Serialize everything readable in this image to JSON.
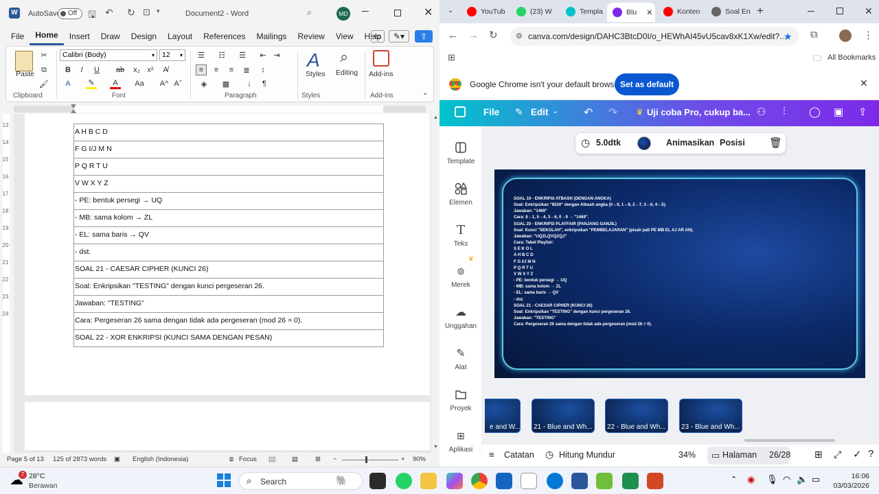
{
  "word": {
    "autosave_label": "AutoSave",
    "autosave_state": "Off",
    "doc_title": "Document2  -  Word",
    "user_initials": "MD",
    "menu": [
      "File",
      "Home",
      "Insert",
      "Draw",
      "Design",
      "Layout",
      "References",
      "Mailings",
      "Review",
      "View",
      "Help"
    ],
    "active_menu": "Home",
    "ribbon": {
      "paste": "Paste",
      "font_name": "Calibri (Body)",
      "font_size": "12",
      "styles": "Styles",
      "editing": "Editing",
      "addins": "Add-ins",
      "groups": {
        "clipboard": "Clipboard",
        "font": "Font",
        "paragraph": "Paragraph",
        "styles": "Styles",
        "addins": "Add-ins"
      }
    },
    "ruler_v_numbers": [
      "13",
      "14",
      "15",
      "16",
      "17",
      "18",
      "19",
      "20",
      "21",
      "22",
      "23",
      "24"
    ],
    "table_rows": [
      "A H B C D",
      "F G I/J M N",
      "P Q R T U",
      "V W X Y Z",
      "- PE: bentuk persegi → UQ",
      "- MB: sama kolom → ZL",
      "- EL: sama baris → QV",
      "- dst.",
      "SOAL 21 - CAESAR CIPHER (KUNCI 26)",
      "Soal: Enkripsikan \"TESTING\" dengan kunci pergeseran 26.",
      "Jawaban: \"TESTING\"",
      "Cara: Pergeseran 26 sama dengan tidak ada pergeseran (mod 26 = 0).",
      "SOAL 22 - XOR ENKRIPSI (KUNCI SAMA DENGAN PESAN)"
    ],
    "status": {
      "page": "Page 5 of 13",
      "words": "125 of 2873 words",
      "language": "English (Indonesia)",
      "focus": "Focus",
      "zoom": "90%"
    }
  },
  "chrome": {
    "tabs": [
      {
        "label": "YouTub",
        "color": "#ff0000"
      },
      {
        "label": "(23) W",
        "color": "#25d366"
      },
      {
        "label": "Templa",
        "color": "#00c4cc"
      },
      {
        "label": "Blu",
        "color": "#7d2ae8"
      },
      {
        "label": "Konten",
        "color": "#ff0000"
      },
      {
        "label": "Soal En",
        "color": "#666666"
      }
    ],
    "url": "canva.com/design/DAHC3BtcD0I/o_HEWhAI45vU5cav8xK1Xw/edit?...",
    "bookmarks_label": "All Bookmarks",
    "infobar_text": "Google Chrome isn't your default browser",
    "infobar_button": "Set as default"
  },
  "canva": {
    "file": "File",
    "edit": "Edit",
    "promo": "Uji coba Pro, cukup ba...",
    "sidebar": [
      "Template",
      "Elemen",
      "Teks",
      "Merek",
      "Unggahan",
      "Alat",
      "Proyek",
      "Aplikasi"
    ],
    "toolbar": {
      "duration": "5.0dtk",
      "animate": "Animasikan",
      "position": "Posisi"
    },
    "slide_lines": [
      "SOAL 19 - ENKRIPSI ATBASH (DENGAN ANGKA)",
      "Soal: Enkripsikan \"8530\" dengan Atbash angka (0↔9, 1↔8, 2↔7, 3↔6, 4↔5).",
      "Jawaban: \"1469\"",
      "Cara: 8→1, 5→4, 3→6, 0→9 → \"1469\".",
      "SOAL 20 - ENKRIPSI PLAYFAIR (PANJANG GANJIL)",
      "Soal: Kunci \"SEKOLAH\", enkripsikan \"PEMBELAJARAN\" (pisah jadi PE MB EL AJ AR AN).",
      "Jawaban: \"UQZLQVQZQJ\"",
      "Cara: Tabel Playfair:",
      "S E K O L",
      "A H B C D",
      "F G I/J M N",
      "P Q R T U",
      "V W X Y Z",
      "- PE: bentuk persegi → UQ",
      "- MB: sama kolom → ZL",
      "- EL: sama baris → QV",
      "- dst.",
      "SOAL 21 - CAESAR CIPHER (KUNCI 26)",
      "Soal: Enkripsikan \"TESTING\" dengan kunci pergeseran 26.",
      "Jawaban: \"TESTING\"",
      "Cara: Pergeseran 26 sama dengan tidak ada pergeseran (mod 26 = 0)."
    ],
    "thumbs": [
      "e and W...",
      "21 - Blue and Wh...",
      "22 - Blue and Wh...",
      "23 - Blue and Wh..."
    ],
    "footer": {
      "notes": "Catatan",
      "timer": "Hitung Mundur",
      "zoom": "34%",
      "pages": "Halaman",
      "page_count": "26/28"
    }
  },
  "taskbar": {
    "temp": "28°C",
    "weather": "Berawan",
    "weather_badge": "7",
    "search": "Search",
    "time": "16:06",
    "date": "03/03/2026"
  }
}
